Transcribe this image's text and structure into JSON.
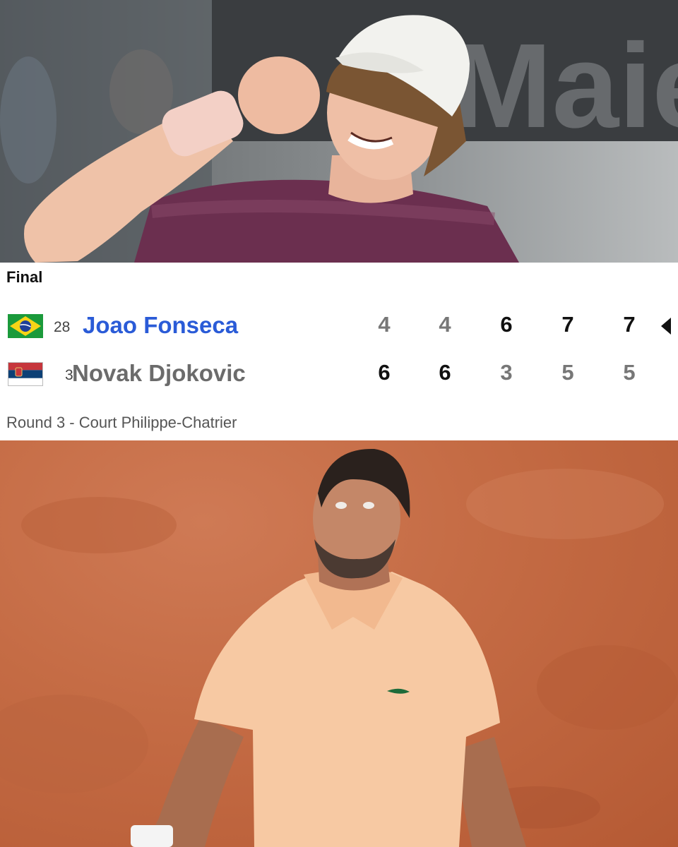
{
  "match": {
    "status": "Final",
    "round_info": "Round 3 - Court Philippe-Chatrier",
    "players": [
      {
        "seed": "28",
        "name": "Joao Fonseca",
        "country": "Brazil",
        "flag_icon": "brazil-flag-icon",
        "sets": [
          "4",
          "4",
          "6",
          "7",
          "7"
        ],
        "winner": true
      },
      {
        "seed": "3",
        "name": "Novak Djokovic",
        "country": "Serbia",
        "flag_icon": "serbia-flag-icon",
        "sets": [
          "6",
          "6",
          "3",
          "5",
          "5"
        ],
        "winner": false
      }
    ]
  },
  "background_sign_text": "Maier",
  "colors": {
    "winner_name": "#2a5bd7",
    "loser_name": "#6b6b6b",
    "clay": "#c56c45"
  }
}
